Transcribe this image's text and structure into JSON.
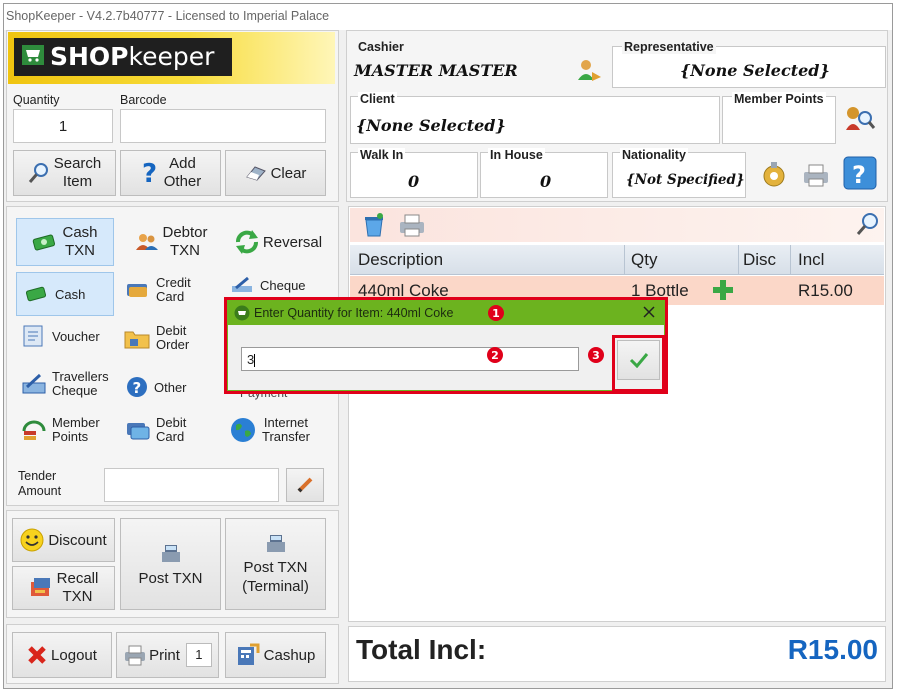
{
  "window": {
    "title": "ShopKeeper - V4.2.7b40777 - Licensed to Imperial Palace"
  },
  "logo": {
    "bold": "SHOP",
    "light": "keeper"
  },
  "entry": {
    "quantity_label": "Quantity",
    "quantity_value": "1",
    "barcode_label": "Barcode",
    "barcode_value": ""
  },
  "actions": {
    "search": {
      "line1": "Search",
      "line2": "Item"
    },
    "add": {
      "line1": "Add",
      "line2": "Other"
    },
    "clear": "Clear"
  },
  "txn_types": {
    "cash": {
      "line1": "Cash",
      "line2": "TXN"
    },
    "debtor": {
      "line1": "Debtor",
      "line2": "TXN"
    },
    "reversal": "Reversal"
  },
  "payment_methods": {
    "cash": "Cash",
    "credit_card": {
      "line1": "Credit",
      "line2": "Card"
    },
    "cheque": "Cheque",
    "voucher": "Voucher",
    "debit_order": {
      "line1": "Debit",
      "line2": "Order"
    },
    "travellers_cheque": {
      "line1": "Travellers",
      "line2": "Cheque"
    },
    "other": "Other",
    "payment": "Payment",
    "member_points": {
      "line1": "Member",
      "line2": "Points"
    },
    "debit_card": {
      "line1": "Debit",
      "line2": "Card"
    },
    "internet_transfer": {
      "line1": "Internet",
      "line2": "Transfer"
    }
  },
  "tender": {
    "label_line1": "Tender",
    "label_line2": "Amount",
    "value": ""
  },
  "bottom_actions": {
    "discount": "Discount",
    "recall": {
      "line1": "Recall",
      "line2": "TXN"
    },
    "post_txn": "Post TXN",
    "post_txn_terminal": {
      "line1": "Post TXN",
      "line2": "(Terminal)"
    }
  },
  "footer": {
    "logout": "Logout",
    "print": "Print",
    "print_copies": "1",
    "cashup": "Cashup"
  },
  "info": {
    "cashier_label": "Cashier",
    "cashier_value": "MASTER MASTER",
    "rep_label": "Representative",
    "rep_value": "{None Selected}",
    "client_label": "Client",
    "client_value": "{None Selected}",
    "points_label": "Member Points",
    "points_value": "",
    "walkin_label": "Walk In",
    "walkin_value": "0",
    "inhouse_label": "In House",
    "inhouse_value": "0",
    "nationality_label": "Nationality",
    "nationality_value": "{Not Specified}"
  },
  "items_table": {
    "headers": {
      "description": "Description",
      "qty": "Qty",
      "disc": "Disc",
      "incl": "Incl"
    },
    "rows": [
      {
        "description": "440ml Coke",
        "qty": "1 Bottle",
        "disc": "",
        "incl": "R15.00"
      }
    ]
  },
  "totals": {
    "label": "Total Incl:",
    "value": "R15.00"
  },
  "dialog": {
    "title": "Enter Quantity for Item: 440ml Coke",
    "input_value": "3",
    "callout_1": "1",
    "callout_2": "2",
    "callout_3": "3"
  },
  "colors": {
    "accent_blue": "#1565c0",
    "dialog_green": "#6cb31f",
    "highlight_red": "#e0001a",
    "logo_yellow": "#f4d01a"
  }
}
